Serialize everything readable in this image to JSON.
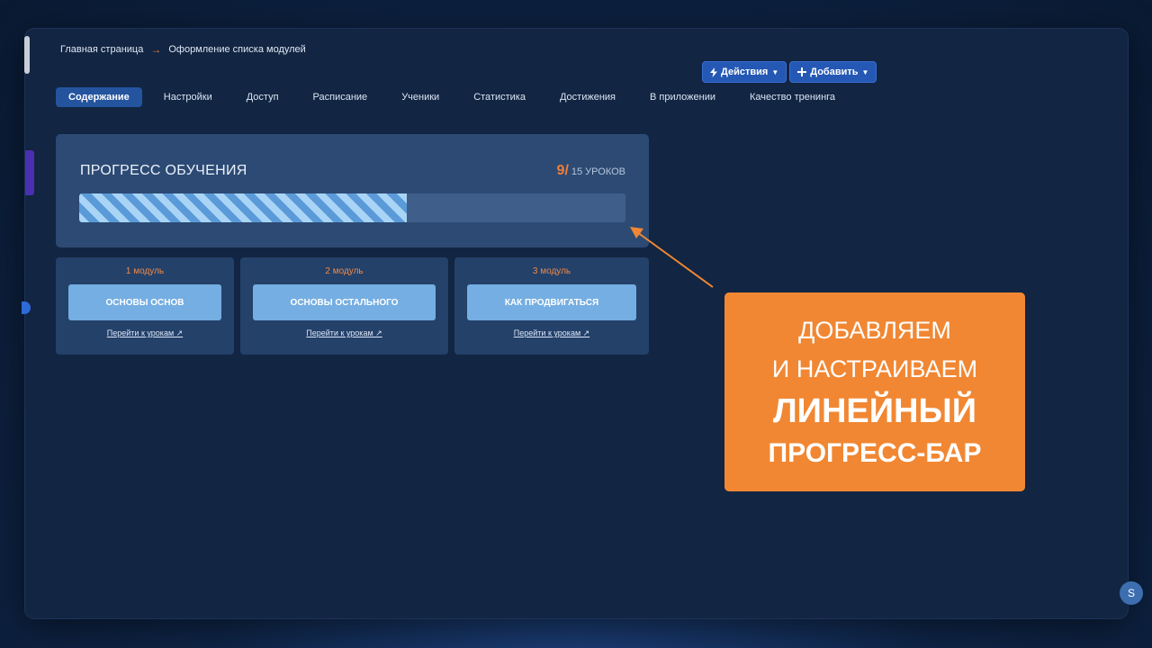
{
  "breadcrumb": {
    "home": "Главная страница",
    "separator": "→",
    "current": "Оформление списка модулей"
  },
  "toolbar": {
    "actions_label": "Действия",
    "actions_icon": "lightning-icon",
    "add_label": "Добавить",
    "add_icon": "plus-icon"
  },
  "tabs": [
    {
      "label": "Содержание",
      "active": true
    },
    {
      "label": "Настройки",
      "active": false
    },
    {
      "label": "Доступ",
      "active": false
    },
    {
      "label": "Расписание",
      "active": false
    },
    {
      "label": "Ученики",
      "active": false
    },
    {
      "label": "Статистика",
      "active": false
    },
    {
      "label": "Достижения",
      "active": false
    },
    {
      "label": "В приложении",
      "active": false
    },
    {
      "label": "Качество тренинга",
      "active": false
    }
  ],
  "progress": {
    "title": "ПРОГРЕСС ОБУЧЕНИЯ",
    "done": "9/",
    "total_text": "15 УРОКОВ",
    "fraction": 0.6
  },
  "modules": [
    {
      "num": "1 модуль",
      "title": "ОСНОВЫ ОСНОВ",
      "link": "Перейти к урокам ↗"
    },
    {
      "num": "2 модуль",
      "title": "ОСНОВЫ ОСТАЛЬНОГО",
      "link": "Перейти к урокам ↗"
    },
    {
      "num": "3 модуль",
      "title": "КАК ПРОДВИГАТЬСЯ",
      "link": "Перейти к урокам ↗"
    }
  ],
  "callout": {
    "line1": "ДОБАВЛЯЕМ",
    "line2": "И НАСТРАИВАЕМ",
    "line3": "ЛИНЕЙНЫЙ",
    "line4": "ПРОГРЕСС-БАР"
  },
  "colors": {
    "accent": "#ef7f3a",
    "tab_active": "#24549e",
    "button": "#2458b4",
    "card": "#2c4a73",
    "module_button": "#75aee2",
    "callout": "#f18733"
  }
}
